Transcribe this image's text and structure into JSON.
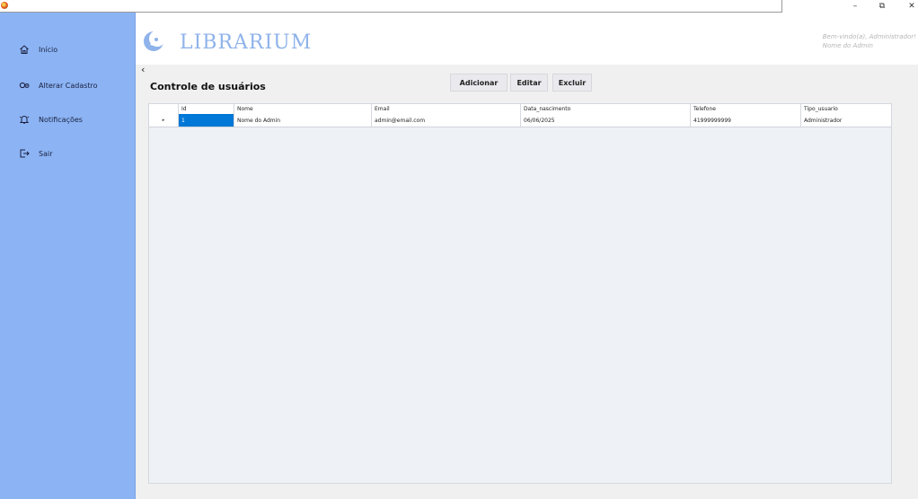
{
  "window": {
    "minimize_glyph": "–",
    "maximize_glyph": "⧉",
    "close_glyph": "✕"
  },
  "sidebar": {
    "items": [
      {
        "label": "Início",
        "icon": "home-icon"
      },
      {
        "label": "Alterar Cadastro",
        "icon": "user-settings-icon"
      },
      {
        "label": "Notificações",
        "icon": "bell-icon"
      },
      {
        "label": "Sair",
        "icon": "logout-icon"
      }
    ]
  },
  "header": {
    "logo_text": "LIBRARIUM",
    "welcome_line1": "Bem-vindo(a), Administrador!",
    "welcome_line2": "Nome do Admin"
  },
  "page": {
    "back_glyph": "‹",
    "title": "Controle de usuários"
  },
  "toolbar": {
    "add_label": "Adicionar",
    "edit_label": "Editar",
    "delete_label": "Excluir"
  },
  "table": {
    "columns": [
      "Id",
      "Nome",
      "Email",
      "Data_nascimento",
      "Telefone",
      "Tipo_usuario"
    ],
    "rows": [
      [
        "1",
        "Nome do Admin",
        "admin@email.com",
        "06/06/2025",
        "41999999999",
        "Administrador"
      ]
    ],
    "row_indicator": "▸"
  },
  "colors": {
    "sidebar": "#8cb4f4",
    "logo": "#8fb3ea",
    "selection": "#0078d7",
    "grid_background": "#eef2f7"
  }
}
